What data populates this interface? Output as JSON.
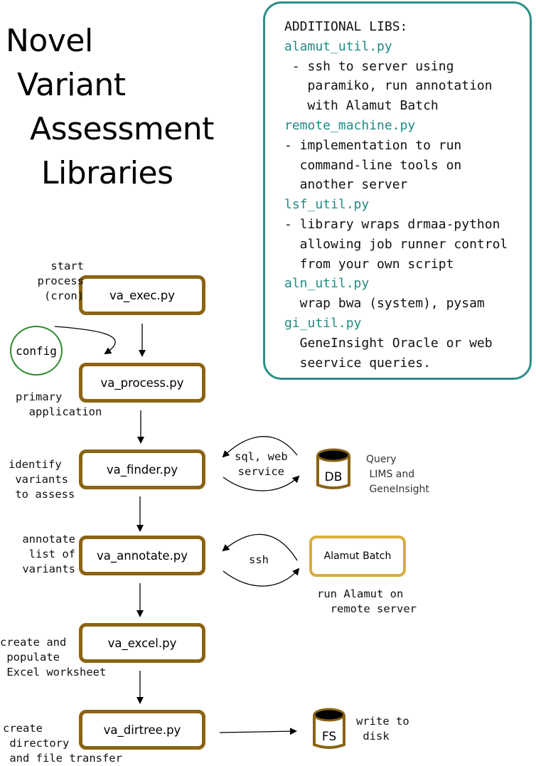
{
  "title": {
    "line1": "Novel",
    "line2": "Variant",
    "line3": "Assessment",
    "line4": "Libraries"
  },
  "additional_libs": {
    "heading": "ADDITIONAL LIBS:",
    "libs": [
      {
        "name": "alamut_util.py",
        "desc": [
          " - ssh to server using",
          "   paramiko, run annotation",
          "   with Alamut Batch"
        ]
      },
      {
        "name": "remote_machine.py",
        "desc": [
          "- implementation to run",
          "  command-line tools on",
          "  another server"
        ]
      },
      {
        "name": "lsf_util.py",
        "desc": [
          "- library wraps drmaa-python",
          "  allowing job runner control",
          "  from your own script"
        ]
      },
      {
        "name": "aln_util.py",
        "desc": [
          "  wrap bwa (system), pysam"
        ]
      },
      {
        "name": "gi_util.py",
        "desc": [
          "  GeneInsight Oracle or web",
          "  seervice queries."
        ]
      }
    ]
  },
  "modules": {
    "exec": "va_exec.py",
    "process": "va_process.py",
    "finder": "va_finder.py",
    "annotate": "va_annotate.py",
    "excel": "va_excel.py",
    "dirtree": "va_dirtree.py"
  },
  "notes": {
    "exec": "start\nprocess\n(cron)",
    "process": "primary\n  application",
    "finder": "identify\n variants\n to assess",
    "annotate": "annotate\nlist of\nvariants",
    "excel": "create and\n populate\n Excel worksheet",
    "dirtree": "create\n directory\n and file transfer"
  },
  "config": "config",
  "finder_link": "sql, web\nservice",
  "db": {
    "label": "DB",
    "note": "Query\n LIMS and\n GeneInsight"
  },
  "annotate_link": "ssh",
  "alamut": {
    "label": "Alamut Batch",
    "note": "run Alamut on\n  remote server"
  },
  "fs": {
    "label": "FS",
    "note": "write to\n disk"
  },
  "colors": {
    "module_border": "#8a6414",
    "libs_border": "#2a8f86",
    "lib_name": "#1e8b85",
    "config_border": "#2e8b2e",
    "alamut_border": "#d9ad3f"
  }
}
